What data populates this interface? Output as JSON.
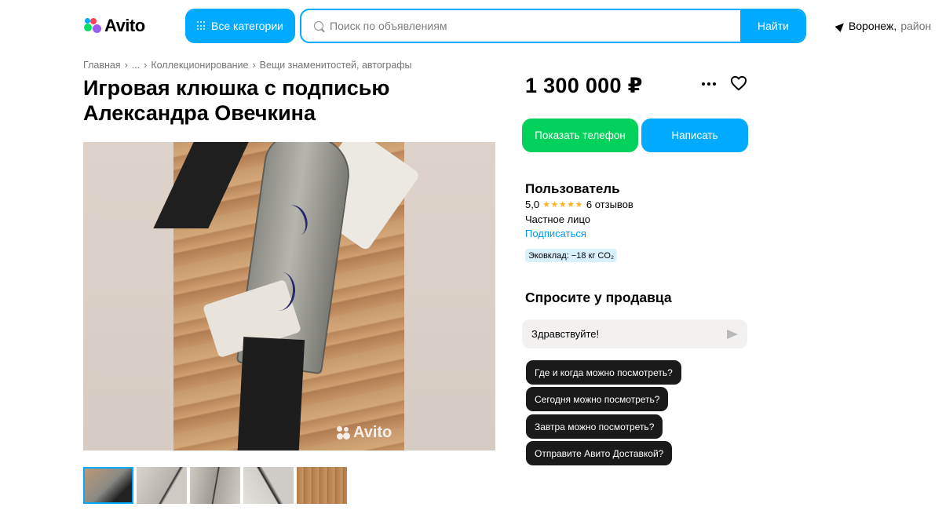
{
  "header": {
    "logo_text": "Avito",
    "categories_label": "Все категории",
    "search_placeholder": "Поиск по объявлениям",
    "search_button": "Найти",
    "location_city": "Воронеж,",
    "location_region": "район",
    "icons": [
      "grid-icon",
      "search-icon",
      "location-arrow-icon"
    ]
  },
  "breadcrumb": {
    "items": [
      "Главная",
      "...",
      "Коллекционирование",
      "Вещи знаменитостей, автографы"
    ],
    "separator": "›"
  },
  "listing": {
    "title": "Игровая клюшка с подписью Александра Овечкина",
    "price": "1 300 000 ₽",
    "photo_watermark": "Avito",
    "thumbnail_count": 5,
    "active_thumbnail": 1
  },
  "actions": {
    "show_phone": "Показать телефон",
    "write": "Написать",
    "icons": [
      "more-icon",
      "heart-icon"
    ]
  },
  "seller": {
    "name": "Пользователь",
    "rating": "5,0",
    "stars": "★★★★★",
    "reviews": "6 отзывов",
    "type": "Частное лицо",
    "subscribe": "Подписаться",
    "eco_badge": "Эковклад: −18 кг CO₂"
  },
  "ask_seller": {
    "title": "Спросите у продавца",
    "input_value": "Здравствуйте!",
    "quick_questions": [
      "Где и когда можно посмотреть?",
      "Сегодня можно посмотреть?",
      "Завтра можно посмотреть?",
      "Отправите Авито Доставкой?"
    ]
  },
  "colors": {
    "accent_blue": "#00aaff",
    "accent_green": "#02d15c",
    "chip_dark": "#1a1a1a",
    "link_blue": "#0099f7",
    "star_yellow": "#ffb021"
  }
}
